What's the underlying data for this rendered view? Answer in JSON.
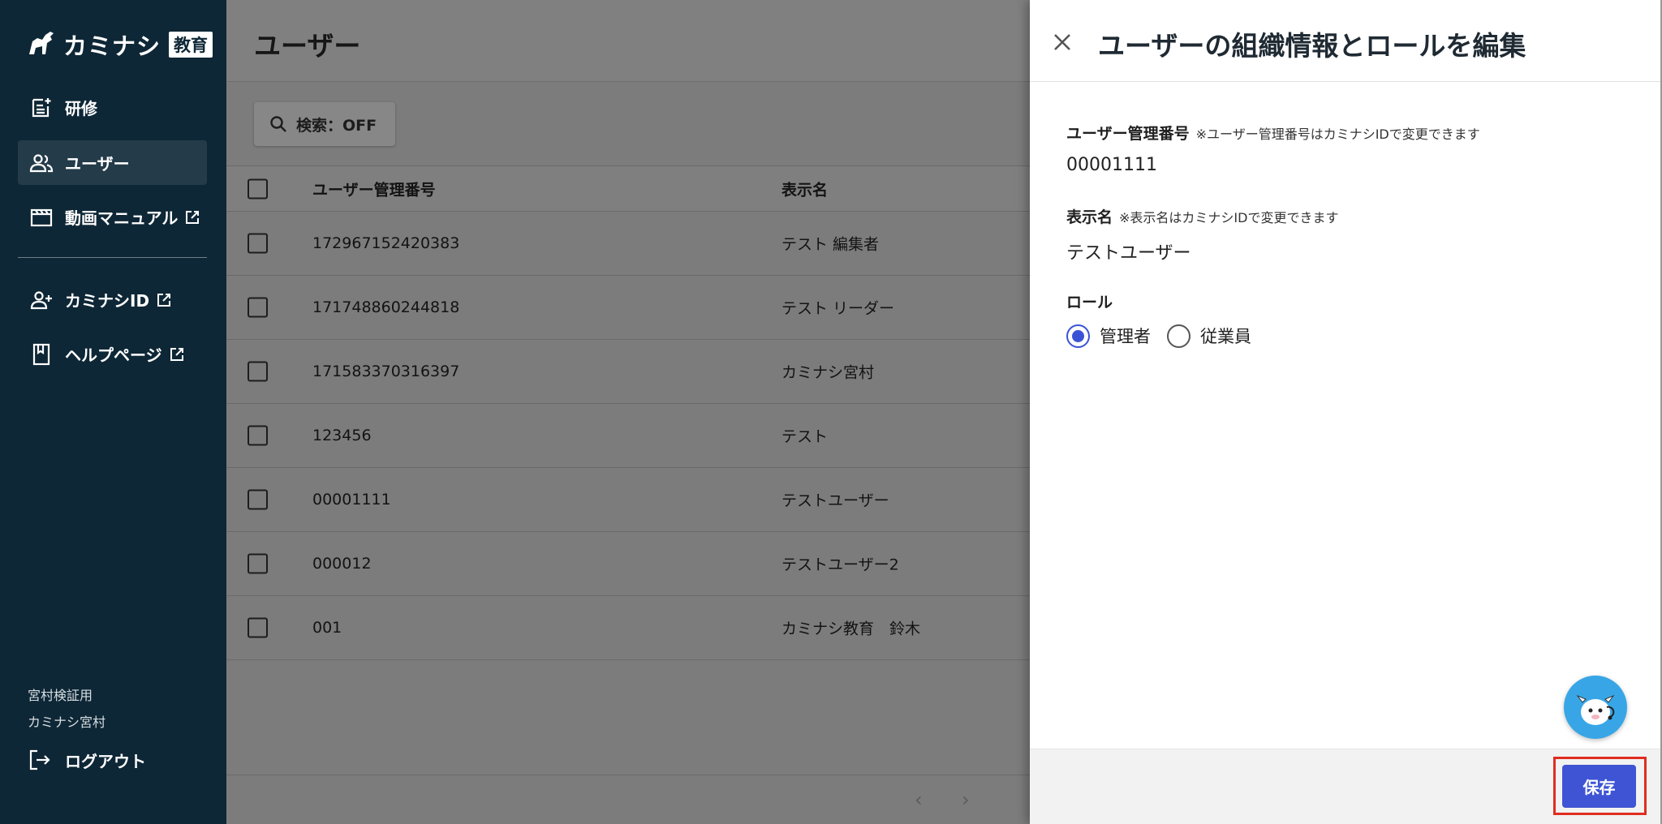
{
  "sidebar": {
    "logo_text": "カミナシ",
    "logo_badge": "教育",
    "items": [
      {
        "label": "研修"
      },
      {
        "label": "ユーザー"
      },
      {
        "label": "動画マニュアル"
      },
      {
        "label": "カミナシID"
      },
      {
        "label": "ヘルプページ"
      }
    ],
    "org_name": "宮村検証用",
    "user_name": "カミナシ宮村",
    "logout_label": "ログアウト"
  },
  "main": {
    "title": "ユーザー",
    "search_label": "検索：OFF",
    "columns": [
      "ユーザー管理番号",
      "表示名"
    ],
    "rows": [
      {
        "id": "172967152420383",
        "name": "テスト 編集者"
      },
      {
        "id": "171748860244818",
        "name": "テスト リーダー"
      },
      {
        "id": "171583370316397",
        "name": "カミナシ宮村"
      },
      {
        "id": "123456",
        "name": "テスト"
      },
      {
        "id": "00001111",
        "name": "テストユーザー"
      },
      {
        "id": "000012",
        "name": "テストユーザー2"
      },
      {
        "id": "001",
        "name": "カミナシ教育　鈴木"
      }
    ],
    "pager_prev": "‹",
    "pager_next": "›"
  },
  "drawer": {
    "title": "ユーザーの組織情報とロールを編集",
    "user_id_label": "ユーザー管理番号",
    "user_id_note": "※ユーザー管理番号はカミナシIDで変更できます",
    "user_id_value": "00001111",
    "display_name_label": "表示名",
    "display_name_note": "※表示名はカミナシIDで変更できます",
    "display_name_value": "テストユーザー",
    "role_label": "ロール",
    "roles": [
      {
        "label": "管理者",
        "checked": true
      },
      {
        "label": "従業員",
        "checked": false
      }
    ],
    "save_label": "保存"
  },
  "colors": {
    "sidebar_bg": "#0e2736",
    "primary": "#3e54d4",
    "highlight_outline": "#e02d1f",
    "chat_bubble": "#38a6e6"
  }
}
